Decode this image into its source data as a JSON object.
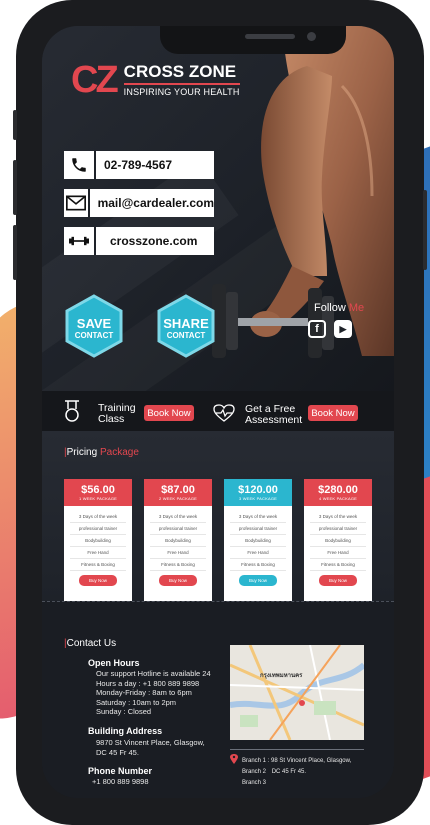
{
  "brand": {
    "mark_c": "C",
    "mark_z": "Z",
    "name": "CROSS ZONE",
    "tagline": "INSPIRING YOUR HEALTH"
  },
  "contacts": {
    "phone": "02-789-4567",
    "email": "mail@cardealer.com",
    "website": "crosszone.com"
  },
  "actions": {
    "save_top": "SAVE",
    "save_bottom": "CONTACT",
    "share_top": "SHARE",
    "share_bottom": "CONTACT"
  },
  "social": {
    "follow": "Follow",
    "me": "Me",
    "facebook_glyph": "f",
    "youtube_glyph": "▶"
  },
  "services": [
    {
      "line1": "Training",
      "line2": "Class",
      "button": "Book Now"
    },
    {
      "line1": "Get a Free",
      "line2": "Assessment",
      "button": "Book Now"
    }
  ],
  "pricing": {
    "title_bar": "|",
    "title_word": "Pricing",
    "title_accent": "Package",
    "plans": [
      {
        "price": "$56.00",
        "period": "1 WEEK PACKAGE",
        "color": "#e2474f",
        "features": [
          "3 Days of the week",
          "professional trainer",
          "Bodybuilding",
          "Free Hand",
          "Fitness & Boxing"
        ],
        "button": "Buy Now"
      },
      {
        "price": "$87.00",
        "period": "2 WEEK PACKAGE",
        "color": "#e2474f",
        "features": [
          "3 Days of the week",
          "professional trainer",
          "Bodybuilding",
          "Free Hand",
          "Fitness & Boxing"
        ],
        "button": "Buy Now"
      },
      {
        "price": "$120.00",
        "period": "3 WEEK PACKAGE",
        "color": "#2bb6cf",
        "features": [
          "3 Days of the week",
          "professional trainer",
          "Bodybuilding",
          "Free Hand",
          "Fitness & Boxing"
        ],
        "button": "Buy Now"
      },
      {
        "price": "$280.00",
        "period": "4 WEEK PACKAGE",
        "color": "#e2474f",
        "features": [
          "3 Days of the week",
          "professional trainer",
          "Bodybuilding",
          "Free Hand",
          "Fitness & Boxing"
        ],
        "button": "Buy Now"
      }
    ]
  },
  "contact_us": {
    "title": "Contact Us",
    "open_hours_title": "Open Hours",
    "open_hours": [
      "Our support Hotline is available 24",
      "Hours a day : +1 800 889 9898",
      "Monday-Friday : 8am to 6pm",
      "Saturday : 10am to 2pm",
      "Sunday : Closed"
    ],
    "address_title": "Building Address",
    "address": [
      "9870 St Vincent Place, Glasgow,",
      "DC 45 Fr 45."
    ],
    "phone_title": "Phone Number",
    "phone": "+1 800 889 9898",
    "map_label": "กรุงเทพมหานคร",
    "branches": [
      {
        "label": "Branch 1 :",
        "text": "98 St Vincent Place, Glasgow,"
      },
      {
        "label": "Branch 2",
        "text": "DC 45 Fr 45."
      },
      {
        "label": "Branch 3",
        "text": ""
      }
    ]
  },
  "colors": {
    "accent": "#e2474f",
    "teal": "#2bb6cf",
    "dark": "#1e2229"
  }
}
